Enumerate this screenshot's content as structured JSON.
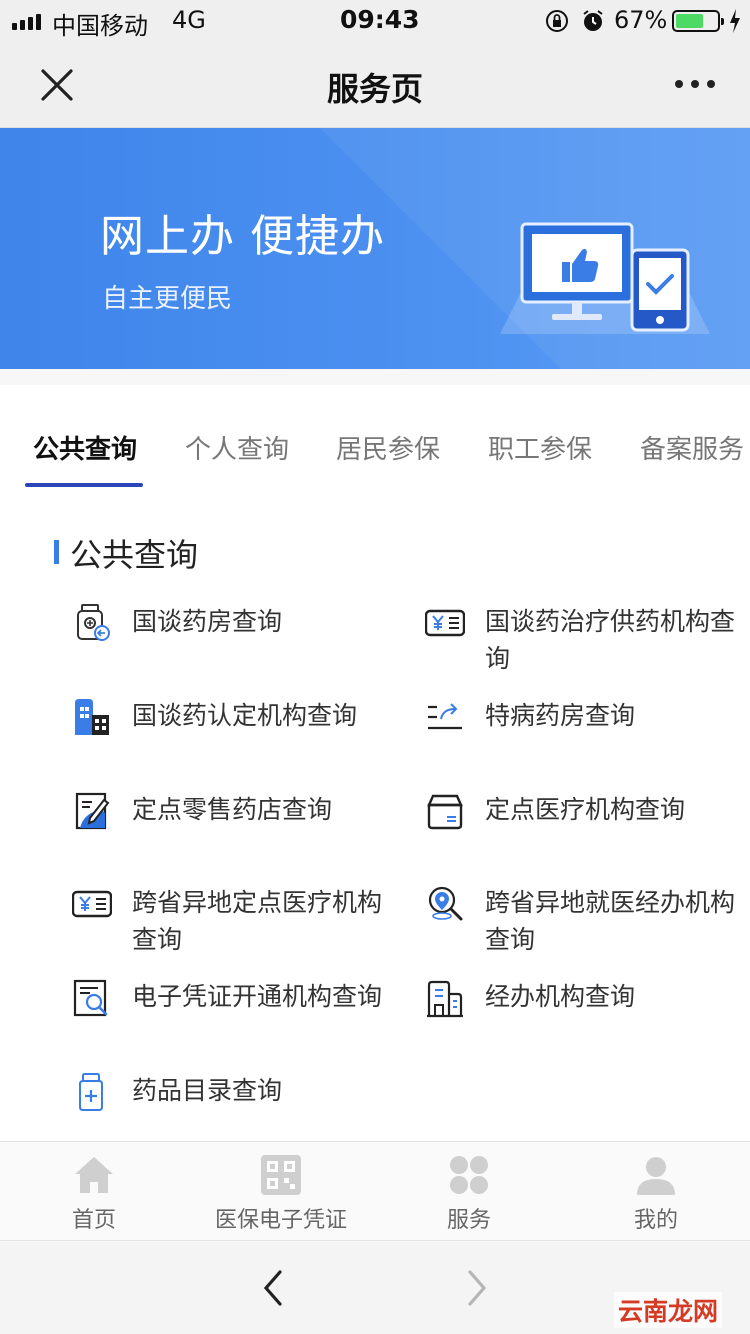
{
  "status_bar": {
    "carrier": "中国移动",
    "network": "4G",
    "time": "09:43",
    "battery_percent": "67%",
    "battery_level": 0.67
  },
  "nav": {
    "title": "服务页"
  },
  "banner": {
    "headline": "网上办 便捷办",
    "subtitle": "自主更便民"
  },
  "tabs": [
    {
      "label": "公共查询",
      "active": true
    },
    {
      "label": "个人查询",
      "active": false
    },
    {
      "label": "居民参保",
      "active": false
    },
    {
      "label": "职工参保",
      "active": false
    },
    {
      "label": "备案服务",
      "active": false
    }
  ],
  "section": {
    "title": "公共查询"
  },
  "services": [
    {
      "label": "国谈药房查询",
      "icon": "pharmacy-bottle-icon"
    },
    {
      "label": "国谈药治疗供药机构查询",
      "icon": "yuan-card-icon"
    },
    {
      "label": "国谈药认定机构查询",
      "icon": "building-icon"
    },
    {
      "label": "特病药房查询",
      "icon": "list-share-icon"
    },
    {
      "label": "定点零售药店查询",
      "icon": "edit-document-icon"
    },
    {
      "label": "定点医疗机构查询",
      "icon": "box-icon"
    },
    {
      "label": "跨省异地定点医疗机构查询",
      "icon": "yuan-card-icon"
    },
    {
      "label": "跨省异地就医经办机构查询",
      "icon": "location-search-icon"
    },
    {
      "label": "电子凭证开通机构查询",
      "icon": "document-search-icon"
    },
    {
      "label": "经办机构查询",
      "icon": "office-building-icon"
    },
    {
      "label": "药品目录查询",
      "icon": "medicine-bottle-icon"
    }
  ],
  "tabbar": [
    {
      "label": "首页",
      "icon": "home-icon"
    },
    {
      "label": "医保电子凭证",
      "icon": "qr-code-icon"
    },
    {
      "label": "服务",
      "icon": "grid-icon"
    },
    {
      "label": "我的",
      "icon": "user-icon"
    }
  ],
  "watermark": "云南龙网"
}
